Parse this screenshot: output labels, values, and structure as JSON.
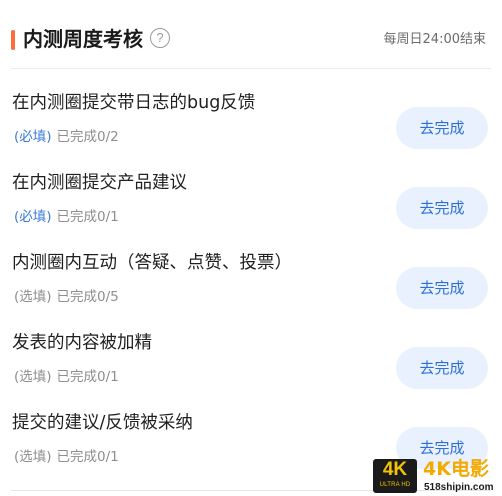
{
  "header": {
    "title": "内测周度考核",
    "help_icon": "?",
    "deadline": "每周日24:00结束",
    "accent_color": "#ff6b3d"
  },
  "tasks": [
    {
      "name": "在内测圈提交带日志的bug反馈",
      "tag": "(必填)",
      "progress": "已完成0/2",
      "action": "去完成",
      "required": true
    },
    {
      "name": "在内测圈提交产品建议",
      "tag": "(必填)",
      "progress": "已完成0/1",
      "action": "去完成",
      "required": true
    },
    {
      "name": "内测圈内互动（答疑、点赞、投票）",
      "tag": "(选填)",
      "progress": "已完成0/5",
      "action": "去完成",
      "required": false
    },
    {
      "name": "发表的内容被加精",
      "tag": "(选填)",
      "progress": "已完成0/1",
      "action": "去完成",
      "required": false
    },
    {
      "name": "提交的建议/反馈被采纳",
      "tag": "(选填)",
      "progress": "已完成0/1",
      "action": "去完成",
      "required": false
    }
  ],
  "colors": {
    "required_tag": "#3b7dd8",
    "optional_tag": "#8e8e8e",
    "button_bg": "#e8f1fd",
    "button_text": "#2d6fd6"
  },
  "watermark": {
    "badge_main": "4K",
    "badge_sub": "ULTRA HD",
    "title": "4K电影",
    "url": "518shipin.com"
  }
}
